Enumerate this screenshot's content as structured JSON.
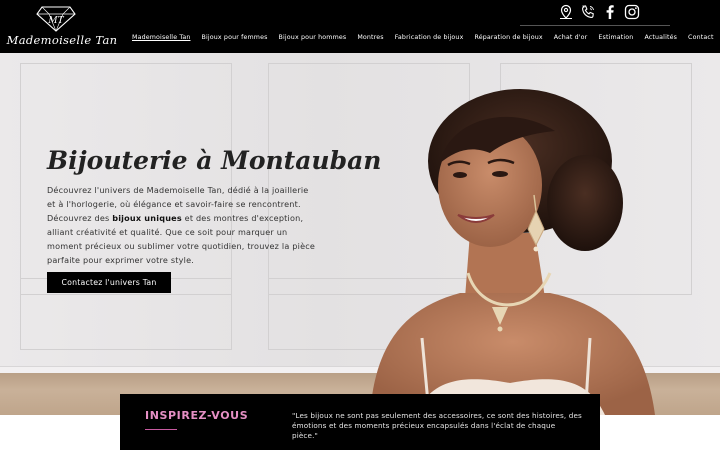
{
  "brand": {
    "name": "Mademoiselle Tan",
    "monogram": "MT"
  },
  "header_icons": [
    "location-pin-icon",
    "phone-icon",
    "facebook-icon",
    "instagram-icon"
  ],
  "nav": {
    "items": [
      {
        "label": "Mademoiselle Tan",
        "active": true
      },
      {
        "label": "Bijoux pour femmes"
      },
      {
        "label": "Bijoux pour hommes"
      },
      {
        "label": "Montres"
      },
      {
        "label": "Fabrication de bijoux"
      },
      {
        "label": "Réparation de bijoux"
      },
      {
        "label": "Achat d'or"
      },
      {
        "label": "Estimation"
      },
      {
        "label": "Actualités"
      },
      {
        "label": "Contact"
      }
    ]
  },
  "hero": {
    "title": "Bijouterie à Montauban",
    "desc_part1": "Découvrez l'univers de Mademoiselle Tan, dédié à la joaillerie et à l'horlogerie, où élégance et savoir-faire se rencontrent. Découvrez des ",
    "desc_bold": "bijoux uniques",
    "desc_part2": " et des montres d'exception, alliant créativité et qualité. Que ce soit pour marquer un moment précieux ou sublimer votre quotidien, trouvez la pièce parfaite pour exprimer votre style.",
    "cta_label": "Contactez l'univers Tan"
  },
  "quote": {
    "title": "INSPIREZ-VOUS",
    "text": "\"Les bijoux ne sont pas seulement des accessoires, ce sont des histoires, des émotions et des moments précieux encapsulés dans l'éclat de chaque pièce.\""
  },
  "colors": {
    "header_bg": "#000000",
    "accent_pink": "#e58fc4",
    "text_dark": "#222222"
  }
}
